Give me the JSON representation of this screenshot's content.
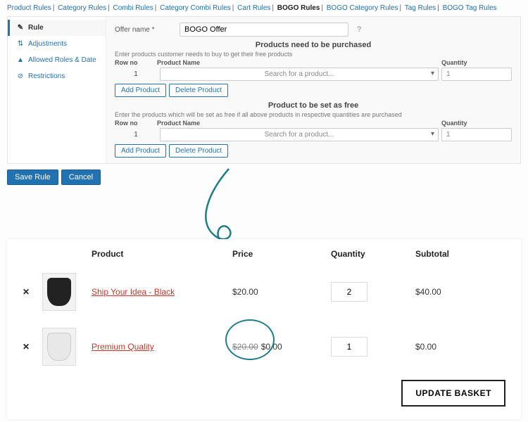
{
  "tabs": [
    {
      "label": "Product Rules",
      "active": false
    },
    {
      "label": "Category Rules",
      "active": false
    },
    {
      "label": "Combi Rules",
      "active": false
    },
    {
      "label": "Category Combi Rules",
      "active": false
    },
    {
      "label": "Cart Rules",
      "active": false
    },
    {
      "label": "BOGO Rules",
      "active": true
    },
    {
      "label": "BOGO Category Rules",
      "active": false
    },
    {
      "label": "Tag Rules",
      "active": false
    },
    {
      "label": "BOGO Tag Rules",
      "active": false
    }
  ],
  "sidebar": {
    "items": [
      {
        "icon": "✎",
        "name": "rule",
        "label": "Rule",
        "active": true
      },
      {
        "icon": "⇅",
        "name": "adjustments",
        "label": "Adjustments",
        "active": false
      },
      {
        "icon": "▲",
        "name": "allowed-roles-date",
        "label": "Allowed Roles & Date",
        "active": false
      },
      {
        "icon": "⊘",
        "name": "restrictions",
        "label": "Restrictions",
        "active": false
      }
    ]
  },
  "form": {
    "offer_label": "Offer name *",
    "offer_value": "BOGO Offer"
  },
  "sections": {
    "purchase": {
      "title": "Products need to be purchased",
      "hint": "Enter products customer needs to buy to get their free products",
      "head_row": "Row no",
      "head_product": "Product Name",
      "head_qty": "Quantity",
      "row_no": "1",
      "select_placeholder": "Search for a product...",
      "qty_value": "1",
      "add_label": "Add Product",
      "delete_label": "Delete Product"
    },
    "free": {
      "title": "Product to be set as free",
      "hint": "Enter the products which will be set as free if all above products in respective quantities are purchased",
      "head_row": "Row no",
      "head_product": "Product Name",
      "head_qty": "Quantity",
      "row_no": "1",
      "select_placeholder": "Search for a product...",
      "qty_value": "1",
      "add_label": "Add Product",
      "delete_label": "Delete Product"
    }
  },
  "footer": {
    "save": "Save Rule",
    "cancel": "Cancel"
  },
  "cart": {
    "head": {
      "product": "Product",
      "price": "Price",
      "qty": "Quantity",
      "subtotal": "Subtotal"
    },
    "rows": [
      {
        "name": "Ship Your Idea - Black",
        "price": "$20.00",
        "strike": "",
        "qty": "2",
        "subtotal": "$40.00",
        "thumb": "dark"
      },
      {
        "name": "Premium Quality",
        "price": "$0.00",
        "strike": "$20.00",
        "qty": "1",
        "subtotal": "$0.00",
        "thumb": "light"
      }
    ],
    "update": "UPDATE BASKET"
  },
  "colors": {
    "accent": "#2271b1",
    "teal": "#1e7d87",
    "link": "#c0392b"
  }
}
